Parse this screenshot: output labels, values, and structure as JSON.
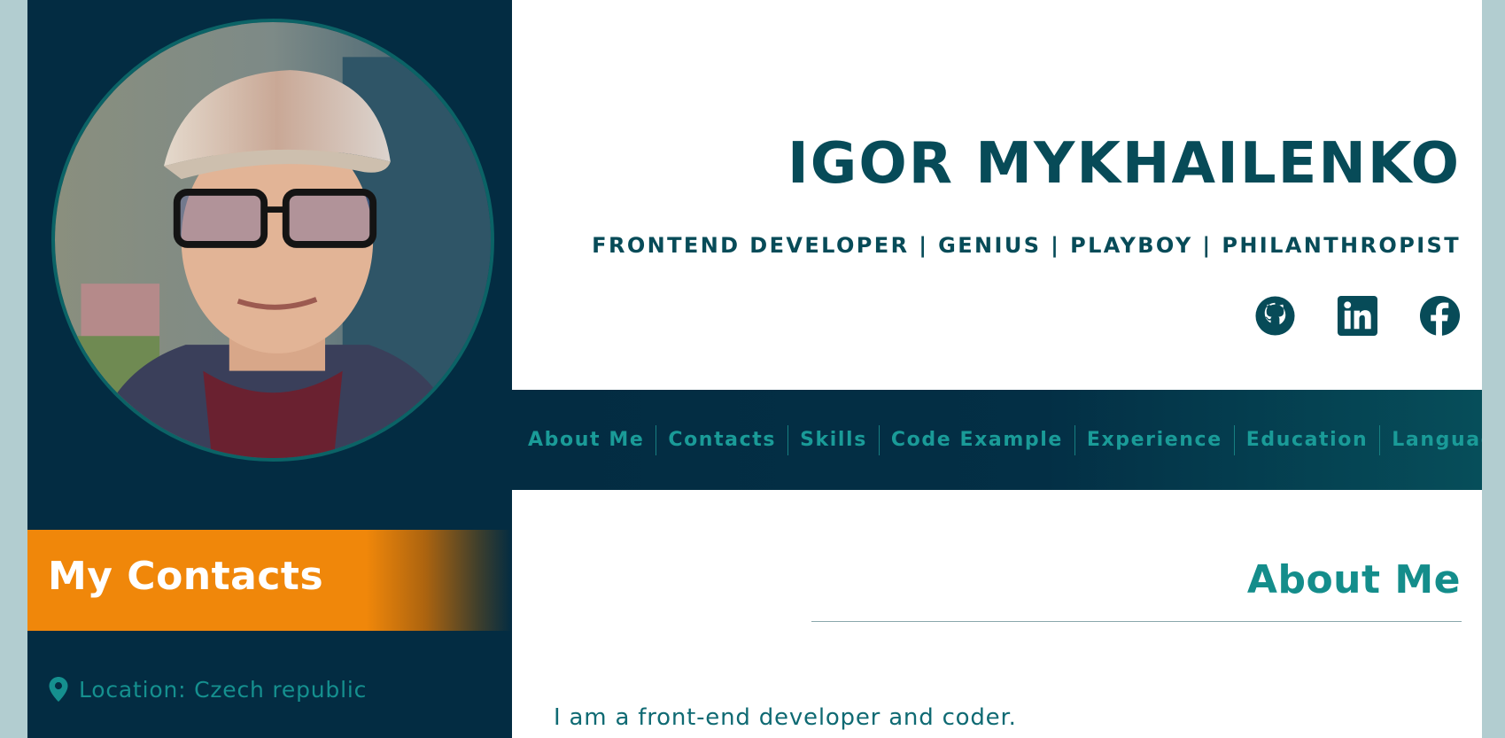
{
  "header": {
    "name": "IGOR MYKHAILENKO",
    "tagline": "FRONTEND DEVELOPER | GENIUS | PLAYBOY | PHILANTHROPIST",
    "socials": [
      {
        "icon": "github-icon"
      },
      {
        "icon": "linkedin-icon"
      },
      {
        "icon": "facebook-icon"
      }
    ]
  },
  "nav": {
    "items": [
      {
        "label": "About Me"
      },
      {
        "label": "Contacts"
      },
      {
        "label": "Skills"
      },
      {
        "label": "Code Example"
      },
      {
        "label": "Experience"
      },
      {
        "label": "Education"
      },
      {
        "label": "Languages"
      }
    ]
  },
  "sidebar": {
    "avatar_icon": "profile-photo",
    "contacts_title": "My Contacts",
    "contacts": [
      {
        "icon": "map-pin-icon",
        "text": "Location: Czech republic"
      }
    ]
  },
  "main": {
    "section_title": "About Me",
    "about_text": "I am a front-end developer and coder."
  },
  "colors": {
    "sidebar_bg": "#032c42",
    "accent_orange": "#f0870a",
    "teal_text": "#15908f",
    "heading_dark": "#074b58",
    "page_bg": "#b2cdd0"
  }
}
